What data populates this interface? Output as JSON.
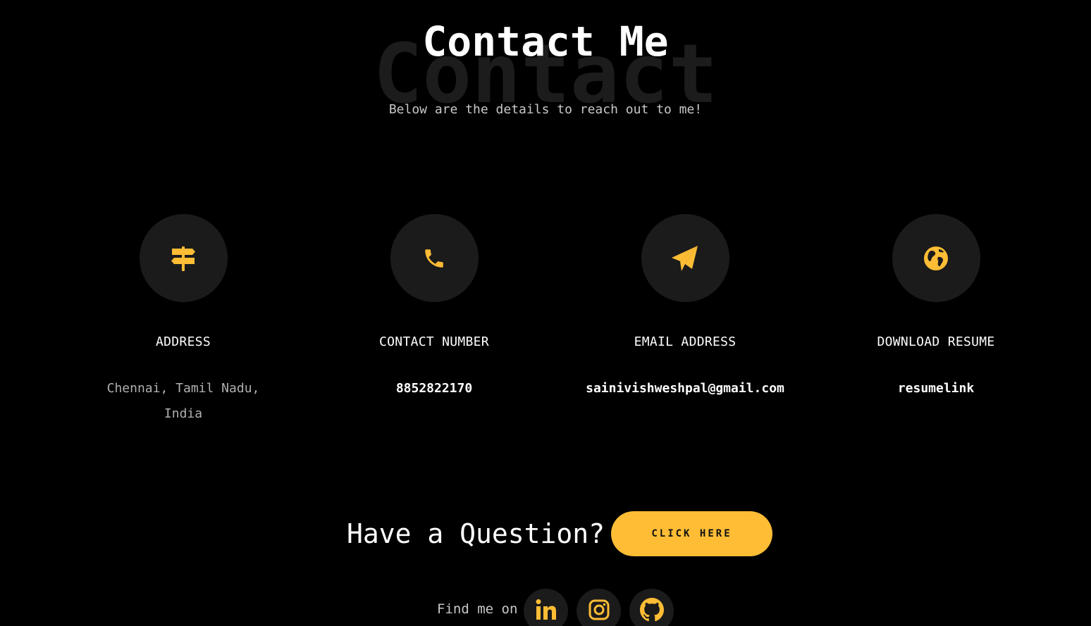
{
  "header": {
    "background_word": "Contact",
    "title": "Contact Me",
    "subtitle": "Below are the details to reach out to me!"
  },
  "accent_color": "#ffbd35",
  "cards": [
    {
      "icon": "signpost-icon",
      "title": "ADDRESS",
      "value": "Chennai, Tamil Nadu, India"
    },
    {
      "icon": "phone-icon",
      "title": "CONTACT NUMBER",
      "value": "8852822170"
    },
    {
      "icon": "paper-plane-icon",
      "title": "EMAIL ADDRESS",
      "value": "sainivishweshpal@gmail.com"
    },
    {
      "icon": "globe-icon",
      "title": "DOWNLOAD RESUME",
      "value": "resumelink"
    }
  ],
  "question": {
    "text": "Have a Question?",
    "button_label": "CLICK HERE"
  },
  "social": {
    "label": "Find me on",
    "links": [
      {
        "icon": "linkedin-icon"
      },
      {
        "icon": "instagram-icon"
      },
      {
        "icon": "github-icon"
      }
    ]
  }
}
